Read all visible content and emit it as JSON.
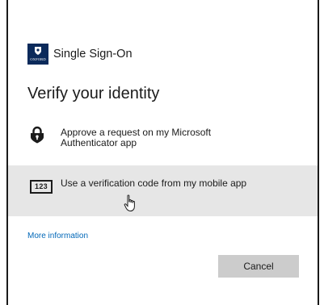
{
  "brand": {
    "logo_text": "OXFORD",
    "name": "Single Sign-On"
  },
  "page": {
    "title": "Verify your identity"
  },
  "options": [
    {
      "label": "Approve a request on my Microsoft Authenticator app",
      "icon": "lock-icon"
    },
    {
      "label": "Use a verification code from my mobile app",
      "icon": "code-icon",
      "icon_text": "123",
      "hovered": true
    }
  ],
  "links": {
    "more_info": "More information"
  },
  "buttons": {
    "cancel": "Cancel"
  },
  "colors": {
    "link": "#0067b8",
    "logo_background": "#0b2a5b",
    "hover_background": "#e6e6e6",
    "button_background": "#cccccc"
  }
}
